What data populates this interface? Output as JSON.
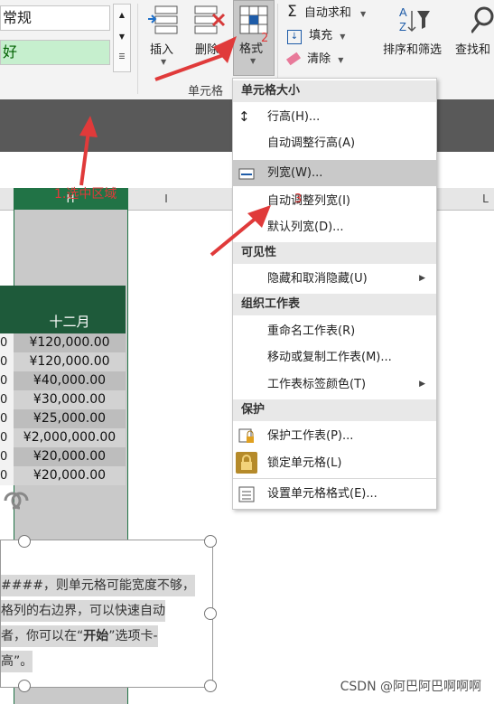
{
  "ribbon": {
    "style_normal": "常规",
    "style_good": "好",
    "insert_label": "插入",
    "delete_label": "删除",
    "format_label": "格式",
    "format_badge": "2",
    "autosum_label": "自动求和",
    "fill_label": "填充",
    "clear_label": "清除",
    "sort_filter_label": "排序和筛选",
    "find_select_label": "查找和",
    "cells_group_label": "单元格",
    "colors": {
      "ribbon_bg": "#f3f3f3",
      "accent_green": "#217346",
      "annotation_red": "#e03a3a"
    }
  },
  "sheet": {
    "columns": [
      "H",
      "I",
      "L"
    ],
    "annotation": "1.选中区域",
    "header_title": "十二月",
    "left_col_values": [
      "0",
      "0",
      "0",
      "0",
      "0",
      "0",
      "0",
      "0"
    ],
    "values": [
      "¥120,000.00",
      "¥120,000.00",
      "¥40,000.00",
      "¥30,000.00",
      "¥25,000.00",
      "¥2,000,000.00",
      "¥20,000.00",
      "¥20,000.00"
    ]
  },
  "menu": {
    "sections": {
      "cell_size": "单元格大小",
      "visibility": "可见性",
      "organize": "组织工作表",
      "protect": "保护"
    },
    "items": {
      "row_height": "行高(H)...",
      "autofit_row": "自动调整行高(A)",
      "col_width": "列宽(W)...",
      "autofit_col": "自动调整列宽(I)",
      "default_width": "默认列宽(D)...",
      "hide_unhide": "隐藏和取消隐藏(U)",
      "rename_sheet": "重命名工作表(R)",
      "move_copy": "移动或复制工作表(M)...",
      "tab_color": "工作表标签颜色(T)",
      "protect_sheet": "保护工作表(P)...",
      "lock_cell": "锁定单元格(L)",
      "format_cells": "设置单元格格式(E)..."
    },
    "step_badge": "3"
  },
  "textbox": {
    "line1": "####，则单元格可能宽度不够，",
    "line2": "格列的右边界，可以快速自动",
    "line3_pre": "者，你可以在“",
    "line3_bold": "开始",
    "line3_post": "”选项卡-",
    "line4": "高”。"
  },
  "watermark": "CSDN @阿巴阿巴啊啊啊"
}
